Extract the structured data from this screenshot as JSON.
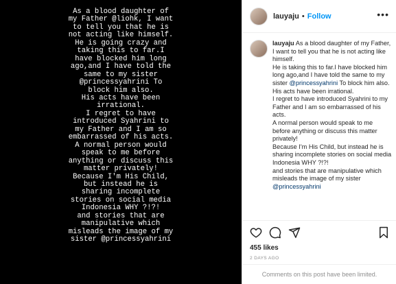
{
  "story": {
    "text": "As a blood daughter of\nmy Father @liohk, I want\nto tell you that he is\nnot acting like himself.\nHe is going crazy and\ntaking this to far.I\nhave blocked him long\nago,and I have told the\nsame to my sister\n@princessyahrini To\nblock him also.\nHis acts have been\nirrational.\nI regret to have\nintroduced Syahrini to\nmy Father and I am so\nembarrassed of his acts.\nA normal person would\nspeak to me before\nanything or discuss this\nmatter privately!\nBecause I'm His Child,\nbut instead he is\nsharing incomplete\nstories on social media\nIndonesia WHY ?!?!\nand stories that are\nmanipulative which\nmisleads the image of my\nsister @princessyahrini"
  },
  "header": {
    "username": "lauyaju",
    "separator": "•",
    "follow_label": "Follow",
    "more_icon": "more-options-icon"
  },
  "caption": {
    "username": "lauyaju",
    "lines": [
      {
        "text": "As a blood daughter of my Father, I want to tell you that he is not acting like himself."
      },
      {
        "text": "He is taking this to far.I have blocked him long ago,and I have told the same to my sister "
      },
      {
        "mention": "@princessyahrini"
      },
      {
        "text": " To block him also."
      },
      {
        "text": "His acts have been irrational."
      },
      {
        "text": "I regret to have introduced Syahrini to my Father and I am so embarrassed of his acts."
      },
      {
        "text": "A normal person would speak to me before anything or discuss this matter privately!"
      },
      {
        "text": "Because I'm His Child, but instead he is sharing incomplete stories on social media Indonesia WHY ?!?!"
      },
      {
        "text": "and stories that are manipulative which misleads the image of my sister "
      },
      {
        "mention": "@princessyahrini"
      }
    ],
    "p1": "As a blood daughter of my Father, I want to tell you that he is not acting like himself.",
    "p2": "He is taking this to far.I have blocked him long ago,and I have told the same to my sister ",
    "mention1": "@princessyahrini",
    "p2b": " To block him also.",
    "p3": "His acts have been irrational.",
    "p4": "I regret to have introduced Syahrini to my Father and I am so embarrassed of his acts.",
    "p5": "A normal person would speak to me before anything or discuss this matter privately!",
    "p6": "Because I'm His Child, but instead he is sharing incomplete stories on social media Indonesia WHY ?!?!",
    "p7": "and stories that are manipulative which misleads the image of my sister ",
    "mention2": "@princessyahrini"
  },
  "actions": {
    "likes": "455 likes",
    "date": "2 DAYS AGO"
  },
  "footer": {
    "limited_text": "Comments on this post have been limited."
  },
  "colors": {
    "accent": "#0095f6",
    "mention": "#00376b",
    "muted": "#8e8e8e",
    "text": "#262626"
  }
}
